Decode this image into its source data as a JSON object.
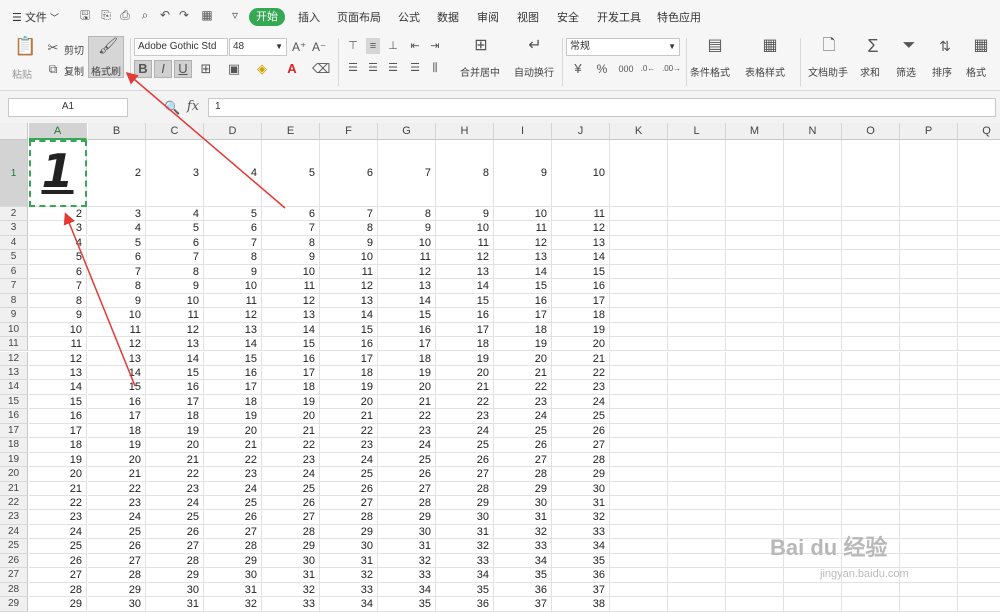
{
  "menu": {
    "file_icon": "hamburger-icon",
    "file_label": "文件",
    "tabs": [
      "开始",
      "插入",
      "页面布局",
      "公式",
      "数据",
      "审阅",
      "视图",
      "安全",
      "开发工具",
      "特色应用"
    ],
    "active_tab": "开始"
  },
  "ribbon": {
    "paste": "粘贴",
    "cut": "剪切",
    "copy": "复制",
    "format_painter": "格式刷",
    "font_name": "Adobe Gothic Std",
    "font_size": "48",
    "bold": "B",
    "italic": "I",
    "underline": "U",
    "merge_center": "合并居中",
    "wrap_text": "自动换行",
    "number_format": "常规",
    "percent": "%",
    "conditional_format": "条件格式",
    "table_style": "表格样式",
    "doc_helper": "文档助手",
    "sum": "求和",
    "filter": "筛选",
    "sort": "排序",
    "format": "格式"
  },
  "formula_bar": {
    "name_box": "A1",
    "fx": "fx",
    "value": "1"
  },
  "sheet": {
    "columns": [
      "A",
      "B",
      "C",
      "D",
      "E",
      "F",
      "G",
      "H",
      "I",
      "J",
      "K",
      "L",
      "M",
      "N",
      "O",
      "P",
      "Q"
    ],
    "row1_label": "1",
    "row1_values": [
      "1",
      "2",
      "3",
      "4",
      "5",
      "6",
      "7",
      "8",
      "9",
      "10"
    ],
    "rows": [
      {
        "n": "2",
        "v": [
          "2",
          "3",
          "4",
          "5",
          "6",
          "7",
          "8",
          "9",
          "10",
          "11"
        ]
      },
      {
        "n": "3",
        "v": [
          "3",
          "4",
          "5",
          "6",
          "7",
          "8",
          "9",
          "10",
          "11",
          "12"
        ]
      },
      {
        "n": "4",
        "v": [
          "4",
          "5",
          "6",
          "7",
          "8",
          "9",
          "10",
          "11",
          "12",
          "13"
        ]
      },
      {
        "n": "5",
        "v": [
          "5",
          "6",
          "7",
          "8",
          "9",
          "10",
          "11",
          "12",
          "13",
          "14"
        ]
      },
      {
        "n": "6",
        "v": [
          "6",
          "7",
          "8",
          "9",
          "10",
          "11",
          "12",
          "13",
          "14",
          "15"
        ]
      },
      {
        "n": "7",
        "v": [
          "7",
          "8",
          "9",
          "10",
          "11",
          "12",
          "13",
          "14",
          "15",
          "16"
        ]
      },
      {
        "n": "8",
        "v": [
          "8",
          "9",
          "10",
          "11",
          "12",
          "13",
          "14",
          "15",
          "16",
          "17"
        ]
      },
      {
        "n": "9",
        "v": [
          "9",
          "10",
          "11",
          "12",
          "13",
          "14",
          "15",
          "16",
          "17",
          "18"
        ]
      },
      {
        "n": "10",
        "v": [
          "10",
          "11",
          "12",
          "13",
          "14",
          "15",
          "16",
          "17",
          "18",
          "19"
        ]
      },
      {
        "n": "11",
        "v": [
          "11",
          "12",
          "13",
          "14",
          "15",
          "16",
          "17",
          "18",
          "19",
          "20"
        ]
      },
      {
        "n": "12",
        "v": [
          "12",
          "13",
          "14",
          "15",
          "16",
          "17",
          "18",
          "19",
          "20",
          "21"
        ]
      },
      {
        "n": "13",
        "v": [
          "13",
          "14",
          "15",
          "16",
          "17",
          "18",
          "19",
          "20",
          "21",
          "22"
        ]
      },
      {
        "n": "14",
        "v": [
          "14",
          "15",
          "16",
          "17",
          "18",
          "19",
          "20",
          "21",
          "22",
          "23"
        ]
      },
      {
        "n": "15",
        "v": [
          "15",
          "16",
          "17",
          "18",
          "19",
          "20",
          "21",
          "22",
          "23",
          "24"
        ]
      },
      {
        "n": "16",
        "v": [
          "16",
          "17",
          "18",
          "19",
          "20",
          "21",
          "22",
          "23",
          "24",
          "25"
        ]
      },
      {
        "n": "17",
        "v": [
          "17",
          "18",
          "19",
          "20",
          "21",
          "22",
          "23",
          "24",
          "25",
          "26"
        ]
      },
      {
        "n": "18",
        "v": [
          "18",
          "19",
          "20",
          "21",
          "22",
          "23",
          "24",
          "25",
          "26",
          "27"
        ]
      },
      {
        "n": "19",
        "v": [
          "19",
          "20",
          "21",
          "22",
          "23",
          "24",
          "25",
          "26",
          "27",
          "28"
        ]
      },
      {
        "n": "20",
        "v": [
          "20",
          "21",
          "22",
          "23",
          "24",
          "25",
          "26",
          "27",
          "28",
          "29"
        ]
      },
      {
        "n": "21",
        "v": [
          "21",
          "22",
          "23",
          "24",
          "25",
          "26",
          "27",
          "28",
          "29",
          "30"
        ]
      },
      {
        "n": "22",
        "v": [
          "22",
          "23",
          "24",
          "25",
          "26",
          "27",
          "28",
          "29",
          "30",
          "31"
        ]
      },
      {
        "n": "23",
        "v": [
          "23",
          "24",
          "25",
          "26",
          "27",
          "28",
          "29",
          "30",
          "31",
          "32"
        ]
      },
      {
        "n": "24",
        "v": [
          "24",
          "25",
          "26",
          "27",
          "28",
          "29",
          "30",
          "31",
          "32",
          "33"
        ]
      },
      {
        "n": "25",
        "v": [
          "25",
          "26",
          "27",
          "28",
          "29",
          "30",
          "31",
          "32",
          "33",
          "34"
        ]
      },
      {
        "n": "26",
        "v": [
          "26",
          "27",
          "28",
          "29",
          "30",
          "31",
          "32",
          "33",
          "34",
          "35"
        ]
      },
      {
        "n": "27",
        "v": [
          "27",
          "28",
          "29",
          "30",
          "31",
          "32",
          "33",
          "34",
          "35",
          "36"
        ]
      },
      {
        "n": "28",
        "v": [
          "28",
          "29",
          "30",
          "31",
          "32",
          "33",
          "34",
          "35",
          "36",
          "37"
        ]
      },
      {
        "n": "29",
        "v": [
          "29",
          "30",
          "31",
          "32",
          "33",
          "34",
          "35",
          "36",
          "37",
          "38"
        ]
      }
    ]
  },
  "colors": {
    "accent": "#35a853",
    "arrow": "#e53935"
  },
  "watermark": {
    "main": "Bai du 经验",
    "sub": "jingyan.baidu.com"
  }
}
